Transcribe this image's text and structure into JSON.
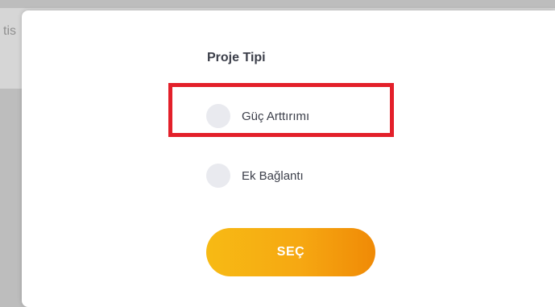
{
  "background": {
    "partial_text": "tis"
  },
  "modal": {
    "title": "Proje Tipi",
    "options": [
      {
        "label": "Güç Arttırımı",
        "selected": false,
        "highlighted": true
      },
      {
        "label": "Ek Bağlantı",
        "selected": false,
        "highlighted": false
      }
    ],
    "select_button_label": "SEÇ"
  },
  "colors": {
    "highlight_border": "#e3202a",
    "button_gradient_start": "#f7ba14",
    "button_gradient_end": "#f08a06",
    "radio_fill": "#e9eaef",
    "text": "#3c3f4a"
  },
  "icons": {
    "radio": "radio-unchecked-icon"
  }
}
